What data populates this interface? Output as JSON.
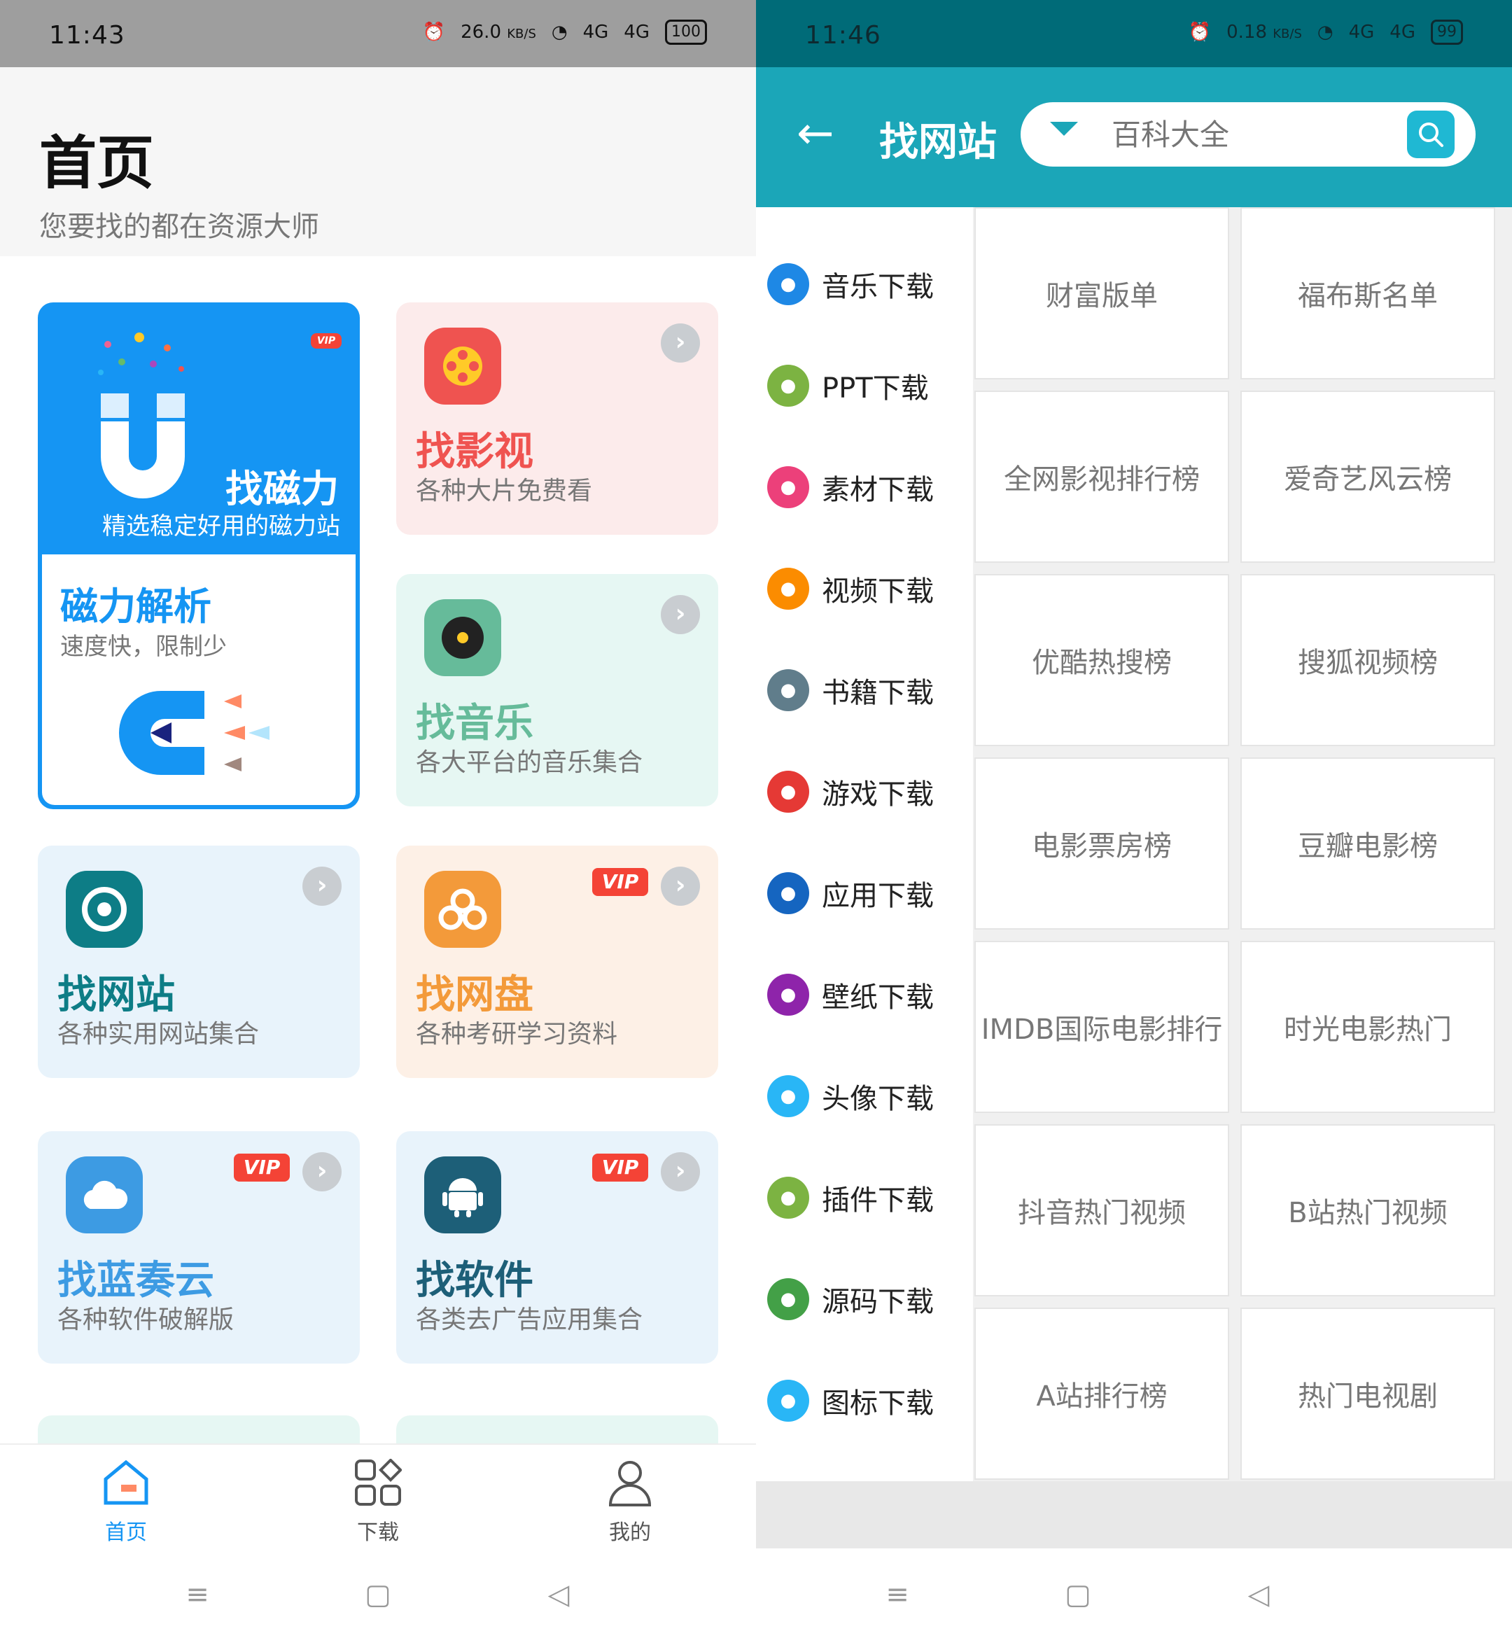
{
  "left": {
    "status": {
      "time": "11:43",
      "speed_top": "26.0",
      "speed_unit": "KB/S",
      "net1": "4G",
      "net2": "4G",
      "battery": "100"
    },
    "header": {
      "title": "首页",
      "subtitle": "您要找的都在资源大师"
    },
    "magnet_card": {
      "vip": "VIP",
      "title": "找磁力",
      "subtitle": "精选稳定好用的磁力站",
      "inner_title": "磁力解析",
      "inner_subtitle": "速度快，限制少"
    },
    "cards": [
      {
        "title": "找影视",
        "subtitle": "各种大片免费看",
        "color": "#ef5350",
        "bg": "#fcebeb"
      },
      {
        "title": "找音乐",
        "subtitle": "各大平台的音乐集合",
        "color": "#66bb9a",
        "bg": "#e6f7f3"
      },
      {
        "title": "找网站",
        "subtitle": "各种实用网站集合",
        "color": "#0d7d86",
        "bg": "#e8f3fb"
      },
      {
        "title": "找网盘",
        "subtitle": "各种考研学习资料",
        "color": "#f39a3a",
        "bg": "#fdf0e6",
        "vip": "VIP"
      },
      {
        "title": "找蓝奏云",
        "subtitle": "各种软件破解版",
        "color": "#3d9be3",
        "bg": "#e8f3fb",
        "vip": "VIP"
      },
      {
        "title": "找软件",
        "subtitle": "各类去广告应用集合",
        "color": "#1d5f78",
        "bg": "#e8f3fb",
        "vip": "VIP"
      }
    ],
    "bottom_nav": [
      {
        "label": "首页",
        "active": true
      },
      {
        "label": "下载",
        "active": false
      },
      {
        "label": "我的",
        "active": false
      }
    ]
  },
  "right": {
    "status": {
      "time": "11:46",
      "speed_top": "0.18",
      "speed_unit": "KB/S",
      "net1": "4G",
      "net2": "4G",
      "battery": "99"
    },
    "header": {
      "title": "找网站",
      "search_placeholder": "百科大全"
    },
    "categories": [
      {
        "label": "音乐下载",
        "color": "#1e88e5"
      },
      {
        "label": "PPT下载",
        "color": "#7cb342"
      },
      {
        "label": "素材下载",
        "color": "#ec407a"
      },
      {
        "label": "视频下载",
        "color": "#fb8c00"
      },
      {
        "label": "书籍下载",
        "color": "#607d8b"
      },
      {
        "label": "游戏下载",
        "color": "#e53935"
      },
      {
        "label": "应用下载",
        "color": "#1565c0"
      },
      {
        "label": "壁纸下载",
        "color": "#8e24aa"
      },
      {
        "label": "头像下载",
        "color": "#29b6f6"
      },
      {
        "label": "插件下载",
        "color": "#7cb342"
      },
      {
        "label": "源码下载",
        "color": "#43a047"
      },
      {
        "label": "图标下载",
        "color": "#29b6f6"
      }
    ],
    "sites": [
      "财富版单",
      "福布斯名单",
      "全网影视排行榜",
      "爱奇艺风云榜",
      "优酷热搜榜",
      "搜狐视频榜",
      "电影票房榜",
      "豆瓣电影榜",
      "IMDB国际电影排行",
      "时光电影热门",
      "抖音热门视频",
      "B站热门视频",
      "A站排行榜",
      "热门电视剧"
    ]
  }
}
